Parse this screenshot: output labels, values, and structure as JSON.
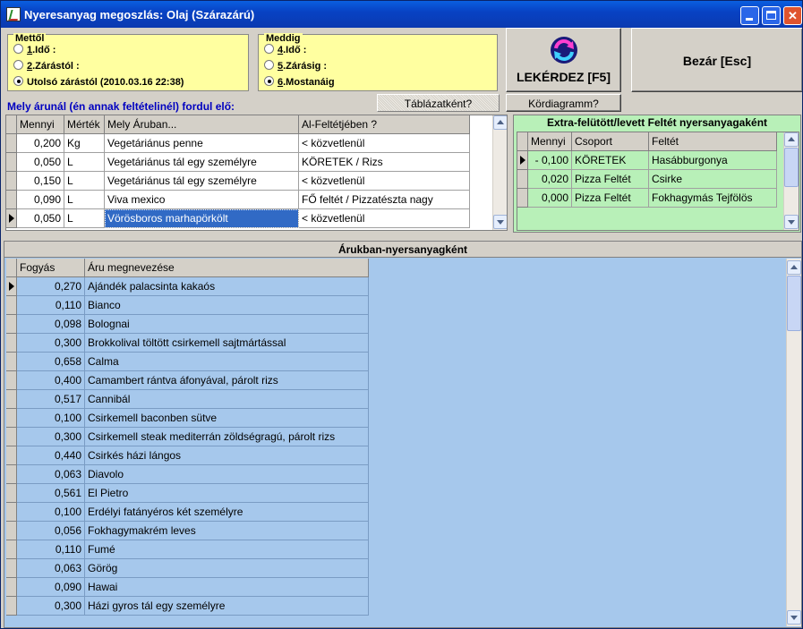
{
  "window": {
    "title": "Nyeresanyag megoszlás: Olaj  (Szárazárú)"
  },
  "mettol": {
    "legend": "Mettől",
    "options": [
      {
        "key": "1",
        "label": ".Idő :",
        "checked": false
      },
      {
        "key": "2",
        "label": ".Zárástól :",
        "checked": false
      },
      {
        "key": "",
        "label": "Utolsó zárástól (2010.03.16 22:38)",
        "checked": true
      }
    ]
  },
  "meddig": {
    "legend": "Meddig",
    "options": [
      {
        "key": "4",
        "label": ".Idő :",
        "checked": false
      },
      {
        "key": "5",
        "label": ".Zárásig :",
        "checked": false
      },
      {
        "key": "6",
        "label": ".Mostanáig",
        "checked": true
      }
    ]
  },
  "buttons": {
    "lekerdez": "LEKÉRDEZ [F5]",
    "bezar": "Bezár [Esc]",
    "tablazatkent": "Táblázatként?",
    "kordiagramm": "Kördiagramm?"
  },
  "question_label": "Mely árunál (én annak feltételinél) fordul elő:",
  "top_grid": {
    "headers": [
      "Mennyi",
      "Mérték",
      "Mely Áruban...",
      "Al-Feltétjében ?"
    ],
    "rows": [
      [
        "0,200",
        "Kg",
        "Vegetáriánus penne",
        "< közvetlenül"
      ],
      [
        "0,050",
        "L",
        "Vegetáriánus tál egy személyre",
        "KÖRETEK / Rizs"
      ],
      [
        "0,150",
        "L",
        "Vegetáriánus tál egy személyre",
        "< közvetlenül"
      ],
      [
        "0,090",
        "L",
        "Viva mexico",
        "FŐ feltét / Pizzatészta nagy"
      ],
      [
        "0,050",
        "L",
        "Vörösboros marhapörkölt",
        "< közvetlenül"
      ]
    ]
  },
  "extra": {
    "title": "Extra-felütött/levett Feltét nyersanyagaként",
    "headers": [
      "Mennyi",
      "Csoport",
      "Feltét"
    ],
    "rows": [
      [
        "- 0,100",
        "KÖRETEK",
        "Hasábburgonya"
      ],
      [
        "0,020",
        "Pizza Feltét",
        "Csirke"
      ],
      [
        "0,000",
        "Pizza Feltét",
        "Fokhagymás Tejfölös"
      ]
    ]
  },
  "bottom": {
    "title": "Árukban-nyersanyagként",
    "headers": [
      "Fogyás",
      "Áru megnevezése"
    ],
    "rows": [
      [
        "0,270",
        "Ajándék palacsinta kakaós"
      ],
      [
        "0,110",
        "Bianco"
      ],
      [
        "0,098",
        "Bolognai"
      ],
      [
        "0,300",
        "Brokkolival töltött csirkemell sajtmártással"
      ],
      [
        "0,658",
        "Calma"
      ],
      [
        "0,400",
        "Camambert rántva áfonyával, párolt rizs"
      ],
      [
        "0,517",
        "Cannibál"
      ],
      [
        "0,100",
        "Csirkemell baconben sütve"
      ],
      [
        "0,300",
        "Csirkemell steak mediterrán zöldségragú, párolt rizs"
      ],
      [
        "0,440",
        "Csirkés házi lángos"
      ],
      [
        "0,063",
        "Diavolo"
      ],
      [
        "0,561",
        "El Pietro"
      ],
      [
        "0,100",
        "Erdélyi fatányéros két személyre"
      ],
      [
        "0,056",
        "Fokhagymakrém leves"
      ],
      [
        "0,110",
        "Fumé"
      ],
      [
        "0,063",
        "Görög"
      ],
      [
        "0,090",
        "Hawai"
      ],
      [
        "0,300",
        "Házi gyros tál egy személyre"
      ]
    ]
  }
}
